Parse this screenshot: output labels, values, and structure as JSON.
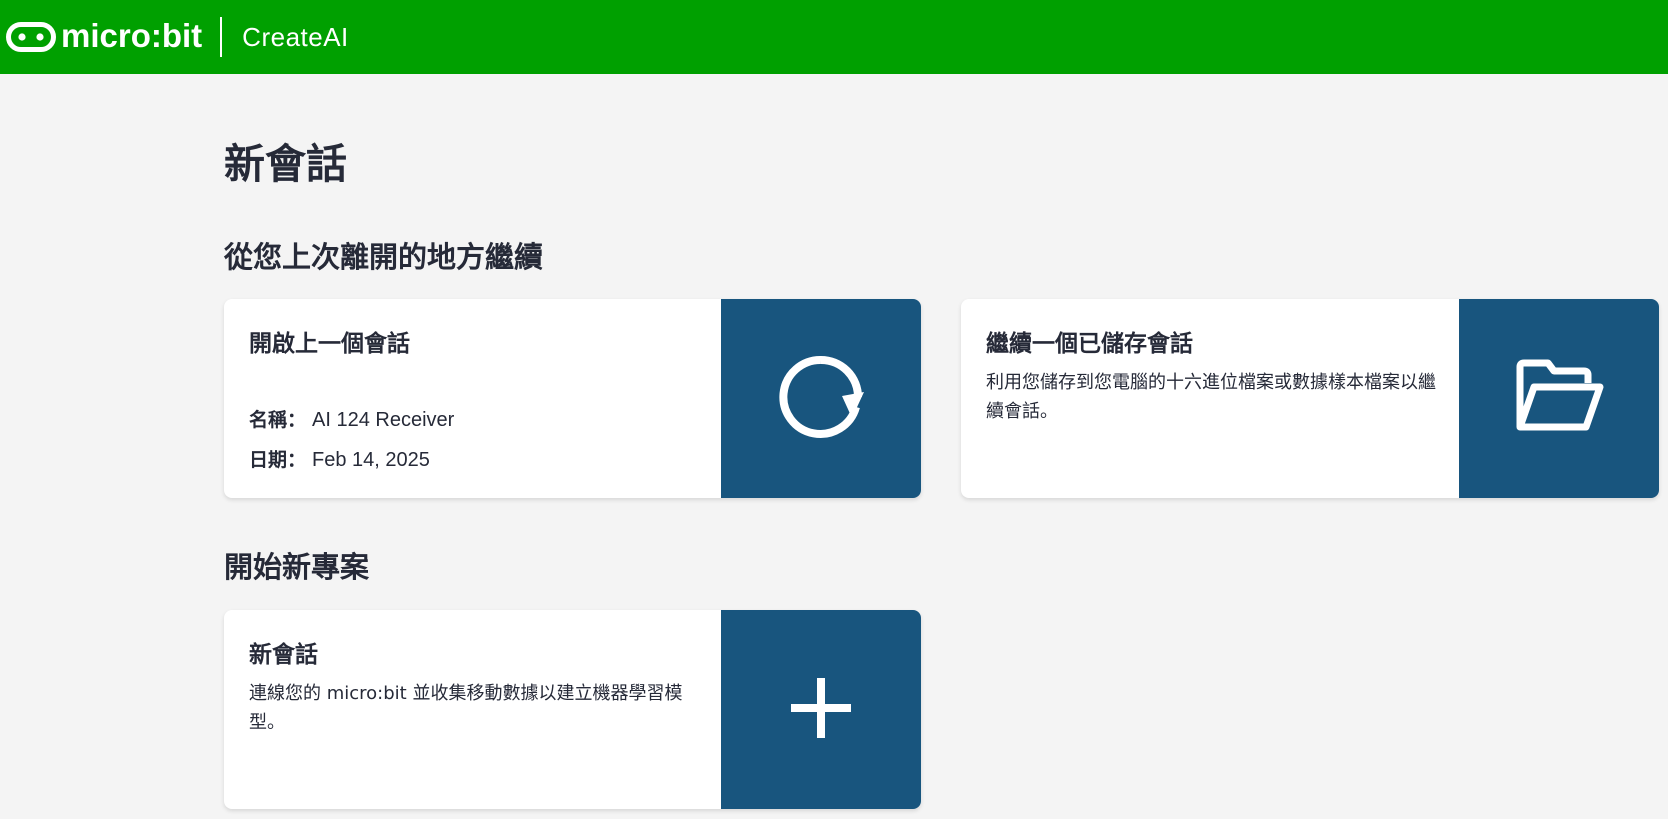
{
  "header": {
    "brand_name": "micro:bit",
    "product_name": "CreateAI",
    "bg_color": "#00a000"
  },
  "page": {
    "title": "新會話"
  },
  "continue_section": {
    "title": "從您上次離開的地方繼續",
    "open_last": {
      "heading": "開啟上一個會話",
      "name_label": "名稱：",
      "name_value": "AI 124 Receiver",
      "date_label": "日期：",
      "date_value": "Feb 14, 2025",
      "icon": "refresh-icon"
    },
    "resume_saved": {
      "heading": "繼續一個已儲存會話",
      "description": "利用您儲存到您電腦的十六進位檔案或數據樣本檔案以繼續會話。",
      "icon": "folder-open-icon"
    }
  },
  "new_section": {
    "title": "開始新專案",
    "new_session": {
      "heading": "新會話",
      "description": "連線您的 micro:bit 並收集移動數據以建立機器學習模型。",
      "icon": "plus-icon"
    }
  },
  "colors": {
    "action_panel": "#18557e",
    "page_bg": "#f4f4f4",
    "text": "#262a38"
  }
}
